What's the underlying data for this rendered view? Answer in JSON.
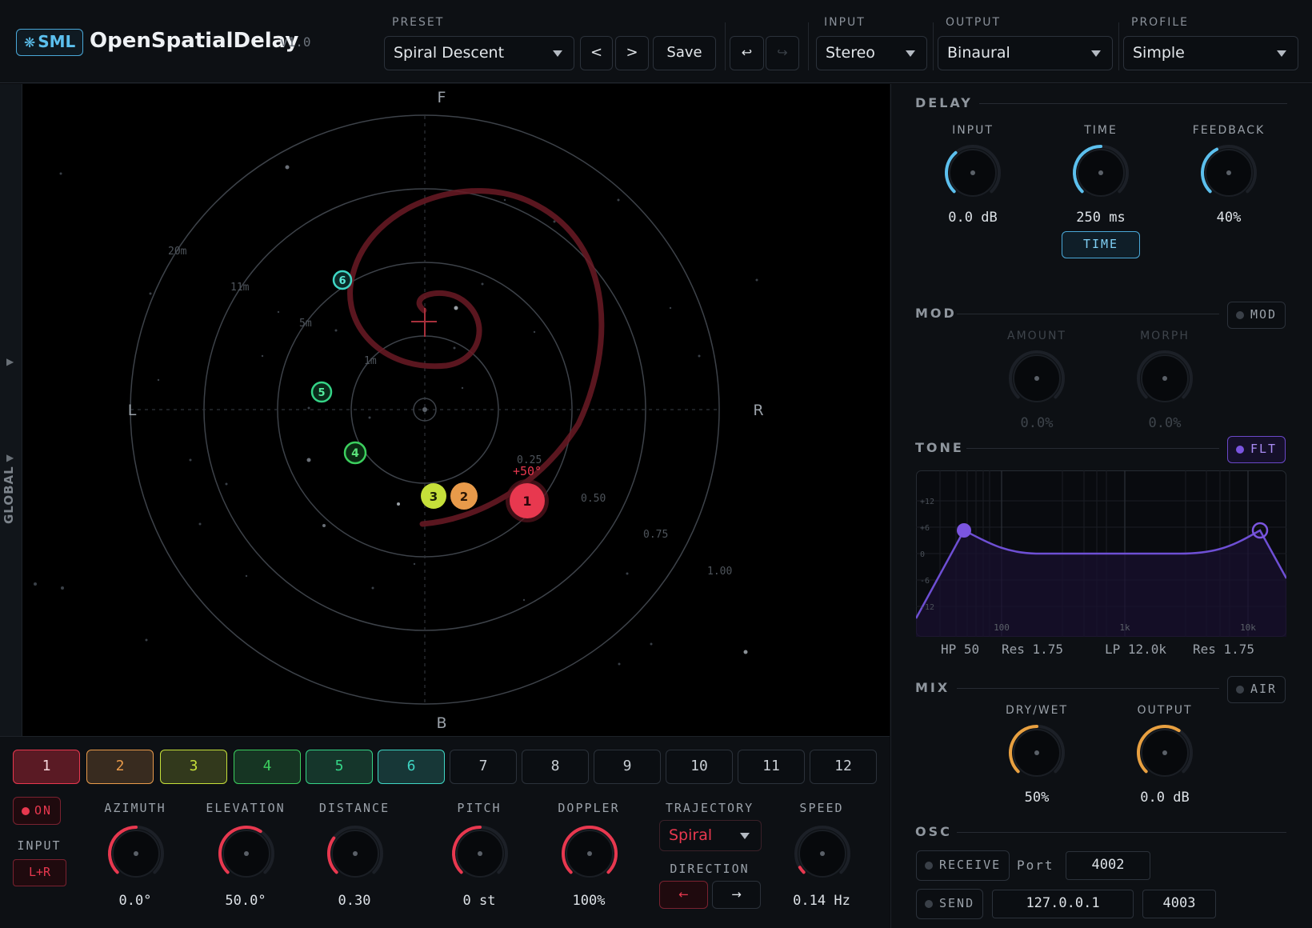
{
  "app": {
    "logo": "SML",
    "title": "OpenSpatialDelay",
    "version": "v1.0"
  },
  "header": {
    "preset": {
      "label": "PRESET",
      "value": "Spiral Descent",
      "prev": "<",
      "next": ">",
      "save": "Save",
      "undo": "↩",
      "redo": "↪"
    },
    "input": {
      "label": "INPUT",
      "value": "Stereo"
    },
    "output": {
      "label": "OUTPUT",
      "value": "Binaural"
    },
    "profile": {
      "label": "PROFILE",
      "value": "Simple"
    }
  },
  "sidebar": {
    "label": "GLOBAL"
  },
  "stage": {
    "compass": {
      "front": "F",
      "back": "B",
      "left": "L",
      "right": "R"
    },
    "ring_labels_m": [
      "20m",
      "11m",
      "5m",
      "1m"
    ],
    "ring_labels_norm": [
      "0.25",
      "0.50",
      "0.75",
      "1.00"
    ],
    "selected_angle": "+50°",
    "voices": [
      {
        "id": "1",
        "color": "#e8384f"
      },
      {
        "id": "2",
        "color": "#e89a4a"
      },
      {
        "id": "3",
        "color": "#c6e03a"
      },
      {
        "id": "4",
        "color": "#3ccf5e"
      },
      {
        "id": "5",
        "color": "#35d487"
      },
      {
        "id": "6",
        "color": "#3fd6c4"
      }
    ]
  },
  "delay": {
    "title": "DELAY",
    "knobs": [
      {
        "label": "INPUT",
        "value": "0.0 dB",
        "level": 0.35
      },
      {
        "label": "TIME",
        "value": "250 ms",
        "level": 0.5
      },
      {
        "label": "FEEDBACK",
        "value": "40%",
        "level": 0.4
      }
    ],
    "time_button": "TIME"
  },
  "mod": {
    "title": "MOD",
    "toggle": "MOD",
    "knobs": [
      {
        "label": "AMOUNT",
        "value": "0.0%"
      },
      {
        "label": "MORPH",
        "value": "0.0%"
      }
    ]
  },
  "tone": {
    "title": "TONE",
    "toggle": "FLT",
    "db_ticks": [
      "+12",
      "+6",
      "0",
      "-6",
      "-12"
    ],
    "freq_ticks": [
      "100",
      "1k",
      "10k"
    ],
    "readout": {
      "hp": "HP 50",
      "hp_res": "Res 1.75",
      "lp": "LP 12.0k",
      "lp_res": "Res 1.75"
    }
  },
  "mix": {
    "title": "MIX",
    "toggle": "AIR",
    "knobs": [
      {
        "label": "DRY/WET",
        "value": "50%",
        "level": 0.5
      },
      {
        "label": "OUTPUT",
        "value": "0.0 dB",
        "level": 0.62
      }
    ]
  },
  "osc": {
    "title": "OSC",
    "receive": "RECEIVE",
    "port_label": "Port",
    "receive_port": "4002",
    "send": "SEND",
    "send_host": "127.0.0.1",
    "send_port": "4003"
  },
  "voice_tabs": [
    "1",
    "2",
    "3",
    "4",
    "5",
    "6",
    "7",
    "8",
    "9",
    "10",
    "11",
    "12"
  ],
  "voice_tab_colors": [
    "#e8384f",
    "#e89a4a",
    "#c6e03a",
    "#3ccf5e",
    "#35d487",
    "#3fd6c4"
  ],
  "voice": {
    "on": "ON",
    "input_label": "INPUT",
    "input_value": "L+R",
    "knobs": [
      {
        "label": "AZIMUTH",
        "value": "0.0°",
        "level": 0.5
      },
      {
        "label": "ELEVATION",
        "value": "50.0°",
        "level": 0.62
      },
      {
        "label": "DISTANCE",
        "value": "0.30",
        "level": 0.3
      },
      {
        "label": "PITCH",
        "value": "0 st",
        "level": 0.5
      },
      {
        "label": "DOPPLER",
        "value": "100%",
        "level": 1.0
      },
      {
        "label": "SPEED",
        "value": "0.14 Hz",
        "level": 0.05
      }
    ],
    "trajectory": {
      "label": "TRAJECTORY",
      "value": "Spiral"
    },
    "direction": {
      "label": "DIRECTION",
      "left": "←",
      "right": "→"
    }
  },
  "colors": {
    "accent_blue": "#5cc0ee",
    "voice_red": "#e8384f",
    "mix_orange": "#e8a040",
    "filter_purple": "#7b55e0"
  }
}
